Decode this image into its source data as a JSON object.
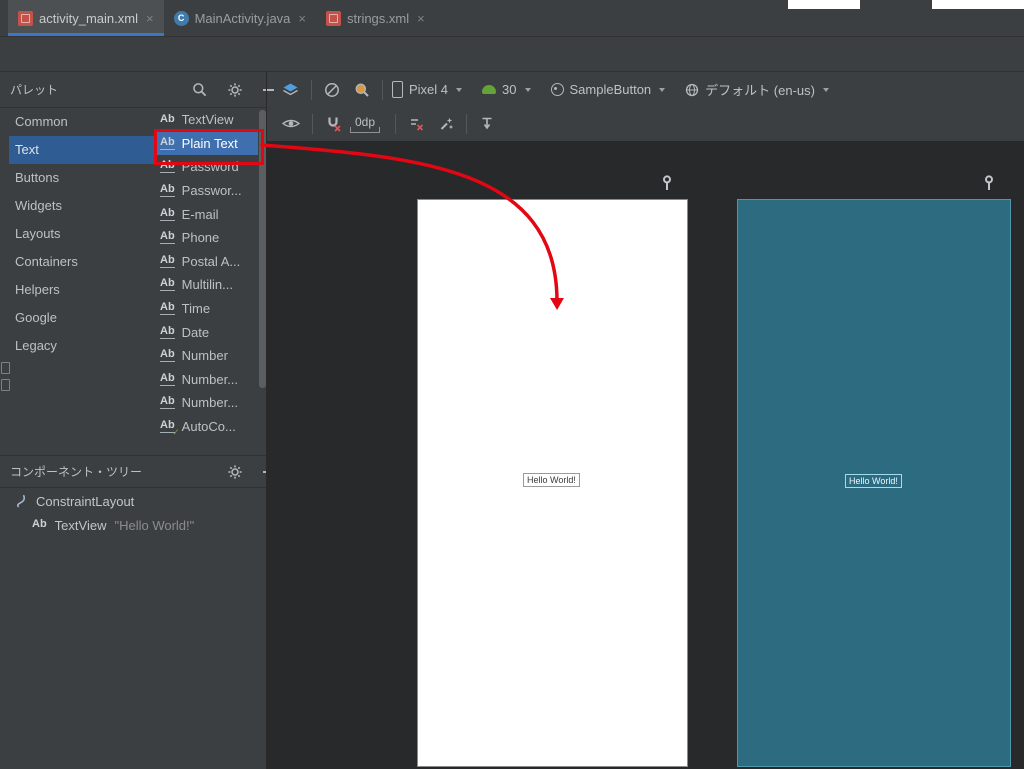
{
  "glyphs": {
    "close": "×",
    "class_icon": "C"
  },
  "tabs": [
    {
      "label": "activity_main.xml"
    },
    {
      "label": "MainActivity.java"
    },
    {
      "label": "strings.xml"
    }
  ],
  "palette": {
    "title": "パレット",
    "selected_category": "Text",
    "categories": [
      {
        "label": "Common"
      },
      {
        "label": "Text"
      },
      {
        "label": "Buttons"
      },
      {
        "label": "Widgets"
      },
      {
        "label": "Layouts"
      },
      {
        "label": "Containers"
      },
      {
        "label": "Helpers"
      },
      {
        "label": "Google"
      },
      {
        "label": "Legacy"
      }
    ],
    "items": [
      {
        "icon": "Ab",
        "label": "TextView"
      },
      {
        "icon": "Ab",
        "label": "Plain Text"
      },
      {
        "icon": "Ab",
        "label": "Password"
      },
      {
        "icon": "Ab",
        "label": "Passwor..."
      },
      {
        "icon": "Ab",
        "label": "E-mail"
      },
      {
        "icon": "Ab",
        "label": "Phone"
      },
      {
        "icon": "Ab",
        "label": "Postal A..."
      },
      {
        "icon": "Ab",
        "label": "Multilin..."
      },
      {
        "icon": "Ab",
        "label": "Time"
      },
      {
        "icon": "Ab",
        "label": "Date"
      },
      {
        "icon": "Ab",
        "label": "Number"
      },
      {
        "icon": "Ab",
        "label": "Number..."
      },
      {
        "icon": "Ab",
        "label": "Number..."
      },
      {
        "icon": "Ab",
        "label": "AutoCo..."
      }
    ]
  },
  "design_toolbar": {
    "device": "Pixel 4",
    "api_level": "30",
    "theme": "SampleButton",
    "locale": "デフォルト (en-us)"
  },
  "layout_toolbar": {
    "default_margin": "0dp"
  },
  "component_tree": {
    "title": "コンポーネント・ツリー",
    "nodes": [
      {
        "label": "ConstraintLayout",
        "value": ""
      },
      {
        "icon": "Ab",
        "label": "TextView",
        "value": "\"Hello World!\""
      }
    ]
  },
  "design_surface": {
    "design_label": "Hello World!",
    "blueprint_label": "Hello World!"
  },
  "colors": {
    "annotation_red": "#e30613",
    "blueprint_teal": "#2d6b80",
    "selection_blue": "#2f5c92",
    "tab_accent": "#3a77c8"
  }
}
